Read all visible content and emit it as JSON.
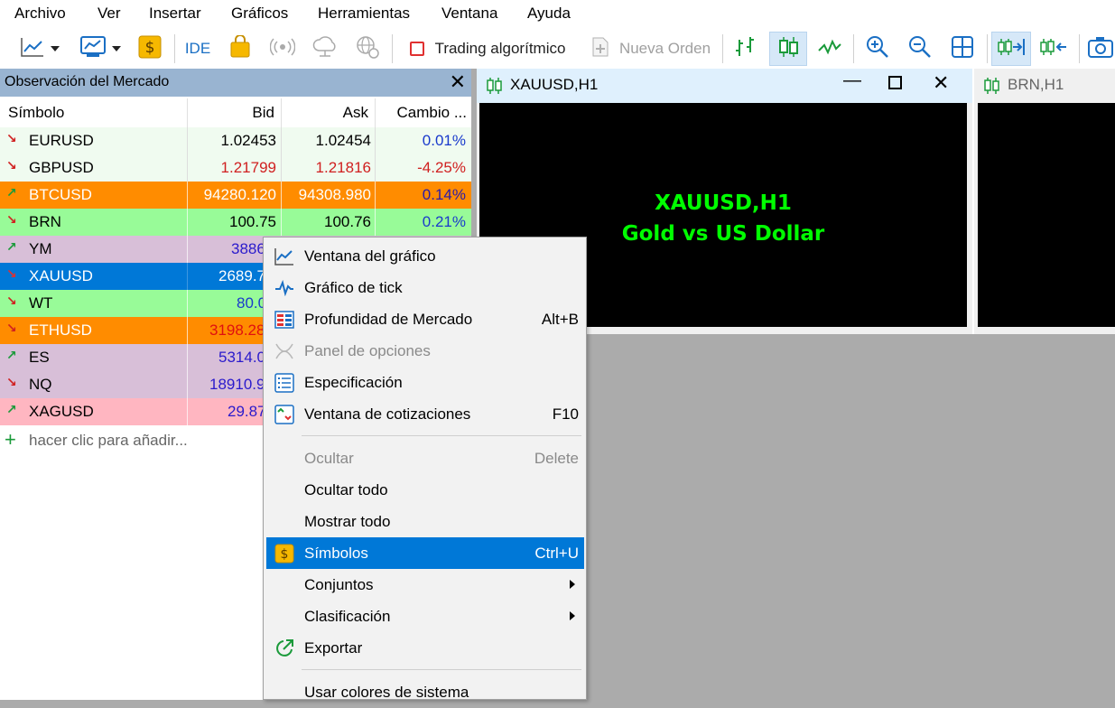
{
  "menubar": {
    "items": [
      "Archivo",
      "Ver",
      "Insertar",
      "Gráficos",
      "Herramientas",
      "Ventana",
      "Ayuda"
    ]
  },
  "toolbar": {
    "ide_label": "IDE",
    "algo_trading_label": "Trading algorítmico",
    "new_order_label": "Nueva Orden"
  },
  "market_watch": {
    "title": "Observación del Mercado",
    "columns": {
      "symbol": "Símbolo",
      "bid": "Bid",
      "ask": "Ask",
      "change": "Cambio ..."
    },
    "rows": [
      {
        "symbol": "EURUSD",
        "bid": "1.02453",
        "ask": "1.02454",
        "change": "0.01%",
        "dir": "down"
      },
      {
        "symbol": "GBPUSD",
        "bid": "1.21799",
        "ask": "1.21816",
        "change": "-4.25%",
        "dir": "down"
      },
      {
        "symbol": "BTCUSD",
        "bid": "94280.120",
        "ask": "94308.980",
        "change": "0.14%",
        "dir": "up"
      },
      {
        "symbol": "BRN",
        "bid": "100.75",
        "ask": "100.76",
        "change": "0.21%",
        "dir": "down"
      },
      {
        "symbol": "YM",
        "bid": "3886",
        "ask": "",
        "change": "",
        "dir": "up"
      },
      {
        "symbol": "XAUUSD",
        "bid": "2689.7",
        "ask": "",
        "change": "",
        "dir": "down"
      },
      {
        "symbol": "WT",
        "bid": "80.0",
        "ask": "",
        "change": "",
        "dir": "down"
      },
      {
        "symbol": "ETHUSD",
        "bid": "3198.28",
        "ask": "",
        "change": "",
        "dir": "down"
      },
      {
        "symbol": "ES",
        "bid": "5314.0",
        "ask": "",
        "change": "",
        "dir": "up"
      },
      {
        "symbol": "NQ",
        "bid": "18910.9",
        "ask": "",
        "change": "",
        "dir": "down"
      },
      {
        "symbol": "XAGUSD",
        "bid": "29.87",
        "ask": "",
        "change": "",
        "dir": "up"
      }
    ],
    "add_label": "hacer clic para añadir..."
  },
  "charts": [
    {
      "title": "XAUUSD,H1",
      "line1": "XAUUSD,H1",
      "line2": "Gold vs US Dollar"
    },
    {
      "title": "BRN,H1"
    }
  ],
  "context_menu": {
    "items": [
      {
        "label": "Ventana del gráfico",
        "shortcut": ""
      },
      {
        "label": "Gráfico de tick",
        "shortcut": ""
      },
      {
        "label": "Profundidad de Mercado",
        "shortcut": "Alt+B"
      },
      {
        "label": "Panel de opciones",
        "shortcut": ""
      },
      {
        "label": "Especificación",
        "shortcut": ""
      },
      {
        "label": "Ventana de cotizaciones",
        "shortcut": "F10"
      },
      {
        "label": "Ocultar",
        "shortcut": "Delete"
      },
      {
        "label": "Ocultar todo",
        "shortcut": ""
      },
      {
        "label": "Mostrar todo",
        "shortcut": ""
      },
      {
        "label": "Símbolos",
        "shortcut": "Ctrl+U"
      },
      {
        "label": "Conjuntos",
        "shortcut": ""
      },
      {
        "label": "Clasificación",
        "shortcut": ""
      },
      {
        "label": "Exportar",
        "shortcut": ""
      },
      {
        "label": "Usar colores de sistema",
        "shortcut": ""
      }
    ]
  },
  "colors": {
    "header_blue": "#99b4d1",
    "selection_blue": "#0078d7",
    "chart_text_green": "#00ff00"
  }
}
